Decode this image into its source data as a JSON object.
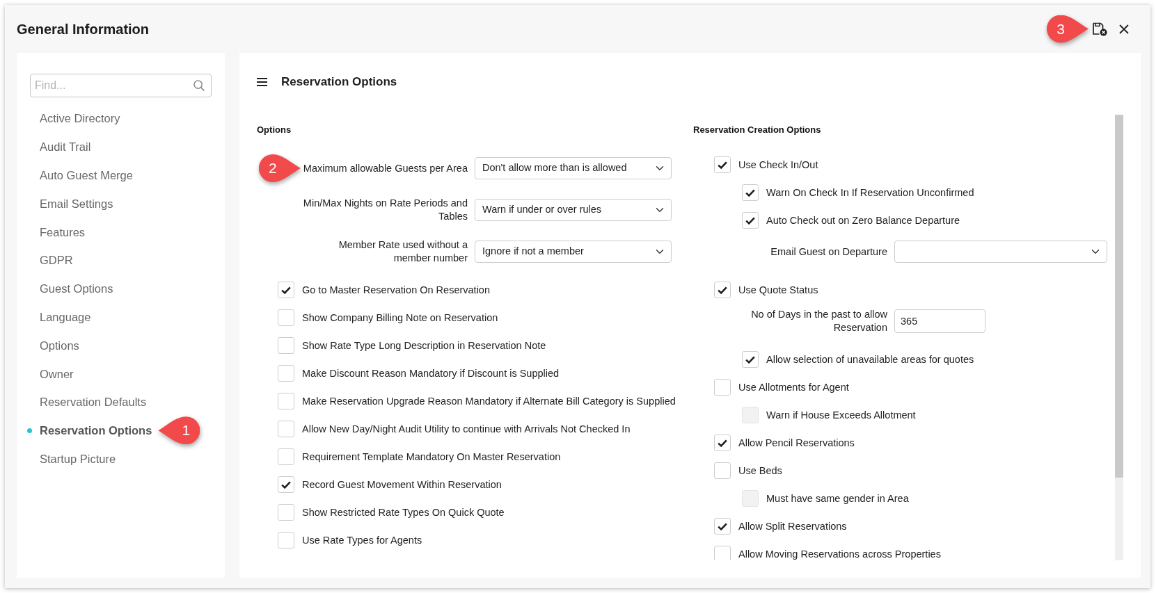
{
  "window": {
    "title": "General Information",
    "save_button": {
      "callout": "3"
    }
  },
  "sidebar": {
    "search": {
      "placeholder": "Find..."
    },
    "items": [
      {
        "label": "Active Directory",
        "selected": false
      },
      {
        "label": "Audit Trail",
        "selected": false
      },
      {
        "label": "Auto Guest Merge",
        "selected": false
      },
      {
        "label": "Email Settings",
        "selected": false
      },
      {
        "label": "Features",
        "selected": false
      },
      {
        "label": "GDPR",
        "selected": false
      },
      {
        "label": "Guest Options",
        "selected": false
      },
      {
        "label": "Language",
        "selected": false
      },
      {
        "label": "Options",
        "selected": false
      },
      {
        "label": "Owner",
        "selected": false
      },
      {
        "label": "Reservation Defaults",
        "selected": false
      },
      {
        "label": "Reservation Options",
        "selected": true,
        "callout": "1"
      },
      {
        "label": "Startup Picture",
        "selected": false
      }
    ]
  },
  "panel": {
    "title": "Reservation Options",
    "columns": [
      {
        "heading": "Options",
        "rows": [
          {
            "kind": "select",
            "label": "Maximum allowable Guests per Area",
            "value": "Don't allow more than is allowed",
            "callout": "2"
          },
          {
            "kind": "select",
            "label": "Min/Max Nights on Rate Periods and Tables",
            "value": "Warn if under or over rules"
          },
          {
            "kind": "select",
            "label": "Member Rate used without a member number",
            "value": "Ignore if not a member"
          },
          {
            "kind": "checkbox",
            "label": "Go to Master Reservation On Reservation",
            "checked": true,
            "disabled": false
          },
          {
            "kind": "checkbox",
            "label": "Show Company Billing Note on Reservation",
            "checked": false,
            "disabled": false
          },
          {
            "kind": "checkbox",
            "label": "Show Rate Type Long Description in Reservation Note",
            "checked": false,
            "disabled": false
          },
          {
            "kind": "checkbox",
            "label": "Make Discount Reason Mandatory if Discount is Supplied",
            "checked": false,
            "disabled": false
          },
          {
            "kind": "checkbox",
            "label": "Make Reservation Upgrade Reason Mandatory if Alternate Bill Category is Supplied",
            "checked": false,
            "disabled": false
          },
          {
            "kind": "checkbox",
            "label": "Allow New Day/Night Audit Utility to continue with Arrivals Not Checked In",
            "checked": false,
            "disabled": false
          },
          {
            "kind": "checkbox",
            "label": "Requirement Template Mandatory On Master Reservation",
            "checked": false,
            "disabled": false
          },
          {
            "kind": "checkbox",
            "label": "Record Guest Movement Within Reservation",
            "checked": true,
            "disabled": false
          },
          {
            "kind": "checkbox",
            "label": "Show Restricted Rate Types On Quick Quote",
            "checked": false,
            "disabled": false
          },
          {
            "kind": "checkbox",
            "label": "Use Rate Types for Agents",
            "checked": false,
            "disabled": false
          }
        ]
      },
      {
        "heading": "Reservation Creation Options",
        "rows": [
          {
            "kind": "checkbox",
            "label": "Use Check In/Out",
            "checked": true,
            "disabled": false,
            "children": [
              {
                "kind": "checkbox",
                "label": "Warn On Check In If Reservation Unconfirmed",
                "checked": true,
                "disabled": false
              },
              {
                "kind": "checkbox",
                "label": "Auto Check out on Zero Balance Departure",
                "checked": true,
                "disabled": false
              },
              {
                "kind": "select",
                "label": "Email Guest on Departure"
              }
            ]
          },
          {
            "kind": "checkbox",
            "label": "Use Quote Status",
            "checked": true,
            "disabled": false,
            "children": [
              {
                "kind": "input",
                "label": "No of Days in the past to allow Reservation",
                "value": "365"
              },
              {
                "kind": "checkbox",
                "label": "Allow selection of unavailable areas for quotes",
                "checked": true,
                "disabled": false
              }
            ]
          },
          {
            "kind": "checkbox",
            "label": "Use Allotments for Agent",
            "checked": false,
            "disabled": false,
            "children": [
              {
                "kind": "checkbox",
                "label": "Warn if House Exceeds Allotment",
                "checked": false,
                "disabled": true
              }
            ]
          },
          {
            "kind": "checkbox",
            "label": "Allow Pencil Reservations",
            "checked": true,
            "disabled": false
          },
          {
            "kind": "checkbox",
            "label": "Use Beds",
            "checked": false,
            "disabled": false,
            "children": [
              {
                "kind": "checkbox",
                "label": "Must have same gender in Area",
                "checked": false,
                "disabled": true
              }
            ]
          },
          {
            "kind": "checkbox",
            "label": "Allow Split Reservations",
            "checked": true,
            "disabled": false
          },
          {
            "kind": "checkbox",
            "label": "Allow Moving Reservations across Properties",
            "checked": false,
            "disabled": false
          }
        ]
      }
    ]
  }
}
